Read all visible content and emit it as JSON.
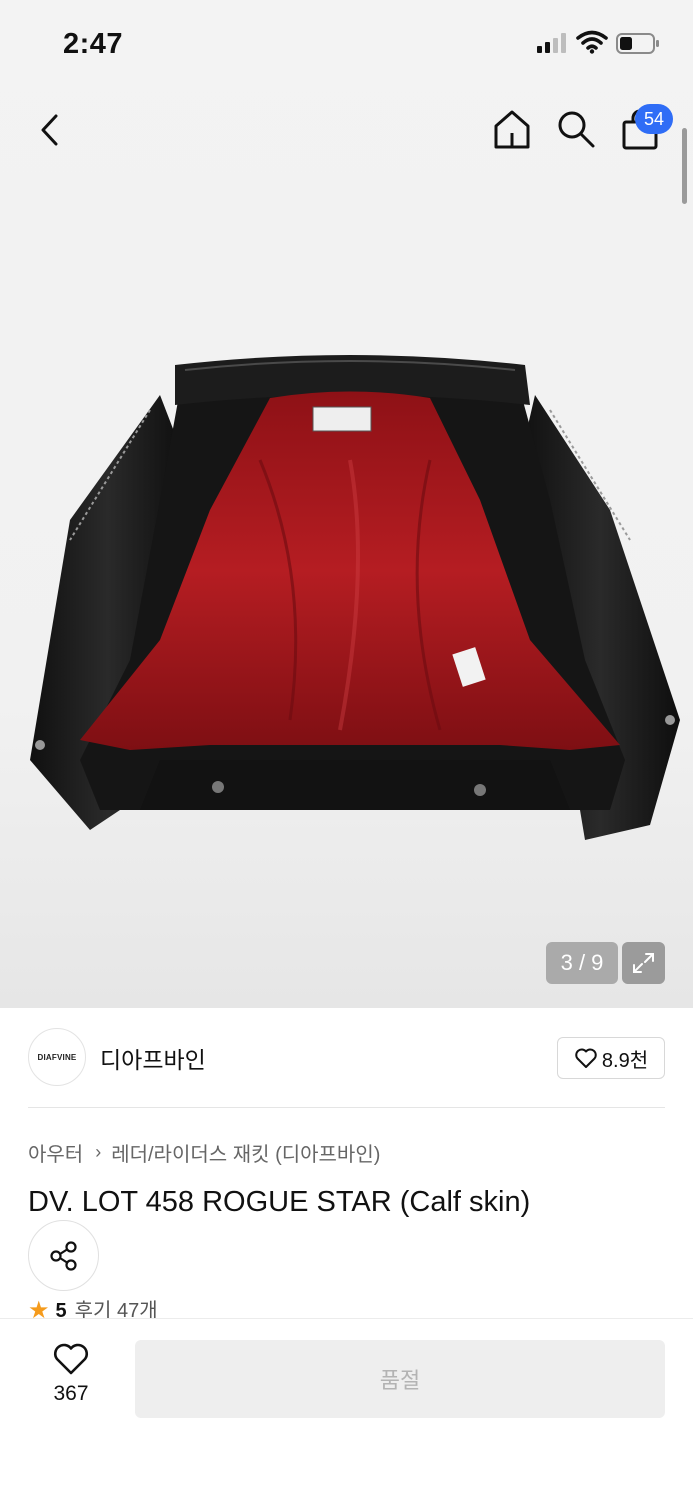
{
  "status_bar": {
    "time": "2:47"
  },
  "nav": {
    "cart_count": "54"
  },
  "gallery": {
    "current": "3",
    "total": "9",
    "pager_text": "3 / 9"
  },
  "brand": {
    "logo_text": "DIAFVINE",
    "name": "디아프바인",
    "like_count": "8.9천"
  },
  "breadcrumb": {
    "category": "아우터",
    "subcategory": "레더/라이더스 재킷 (디아프바인)"
  },
  "product": {
    "title": "DV. LOT 458 ROGUE STAR (Calf skin)",
    "rating": "5",
    "reviews_label": "후기 47개"
  },
  "bottom": {
    "like_count": "367",
    "cta_label": "품절"
  },
  "colors": {
    "badge": "#2f6df6",
    "star": "#f59b1c",
    "lining": "#a3161b",
    "leather": "#141414"
  }
}
